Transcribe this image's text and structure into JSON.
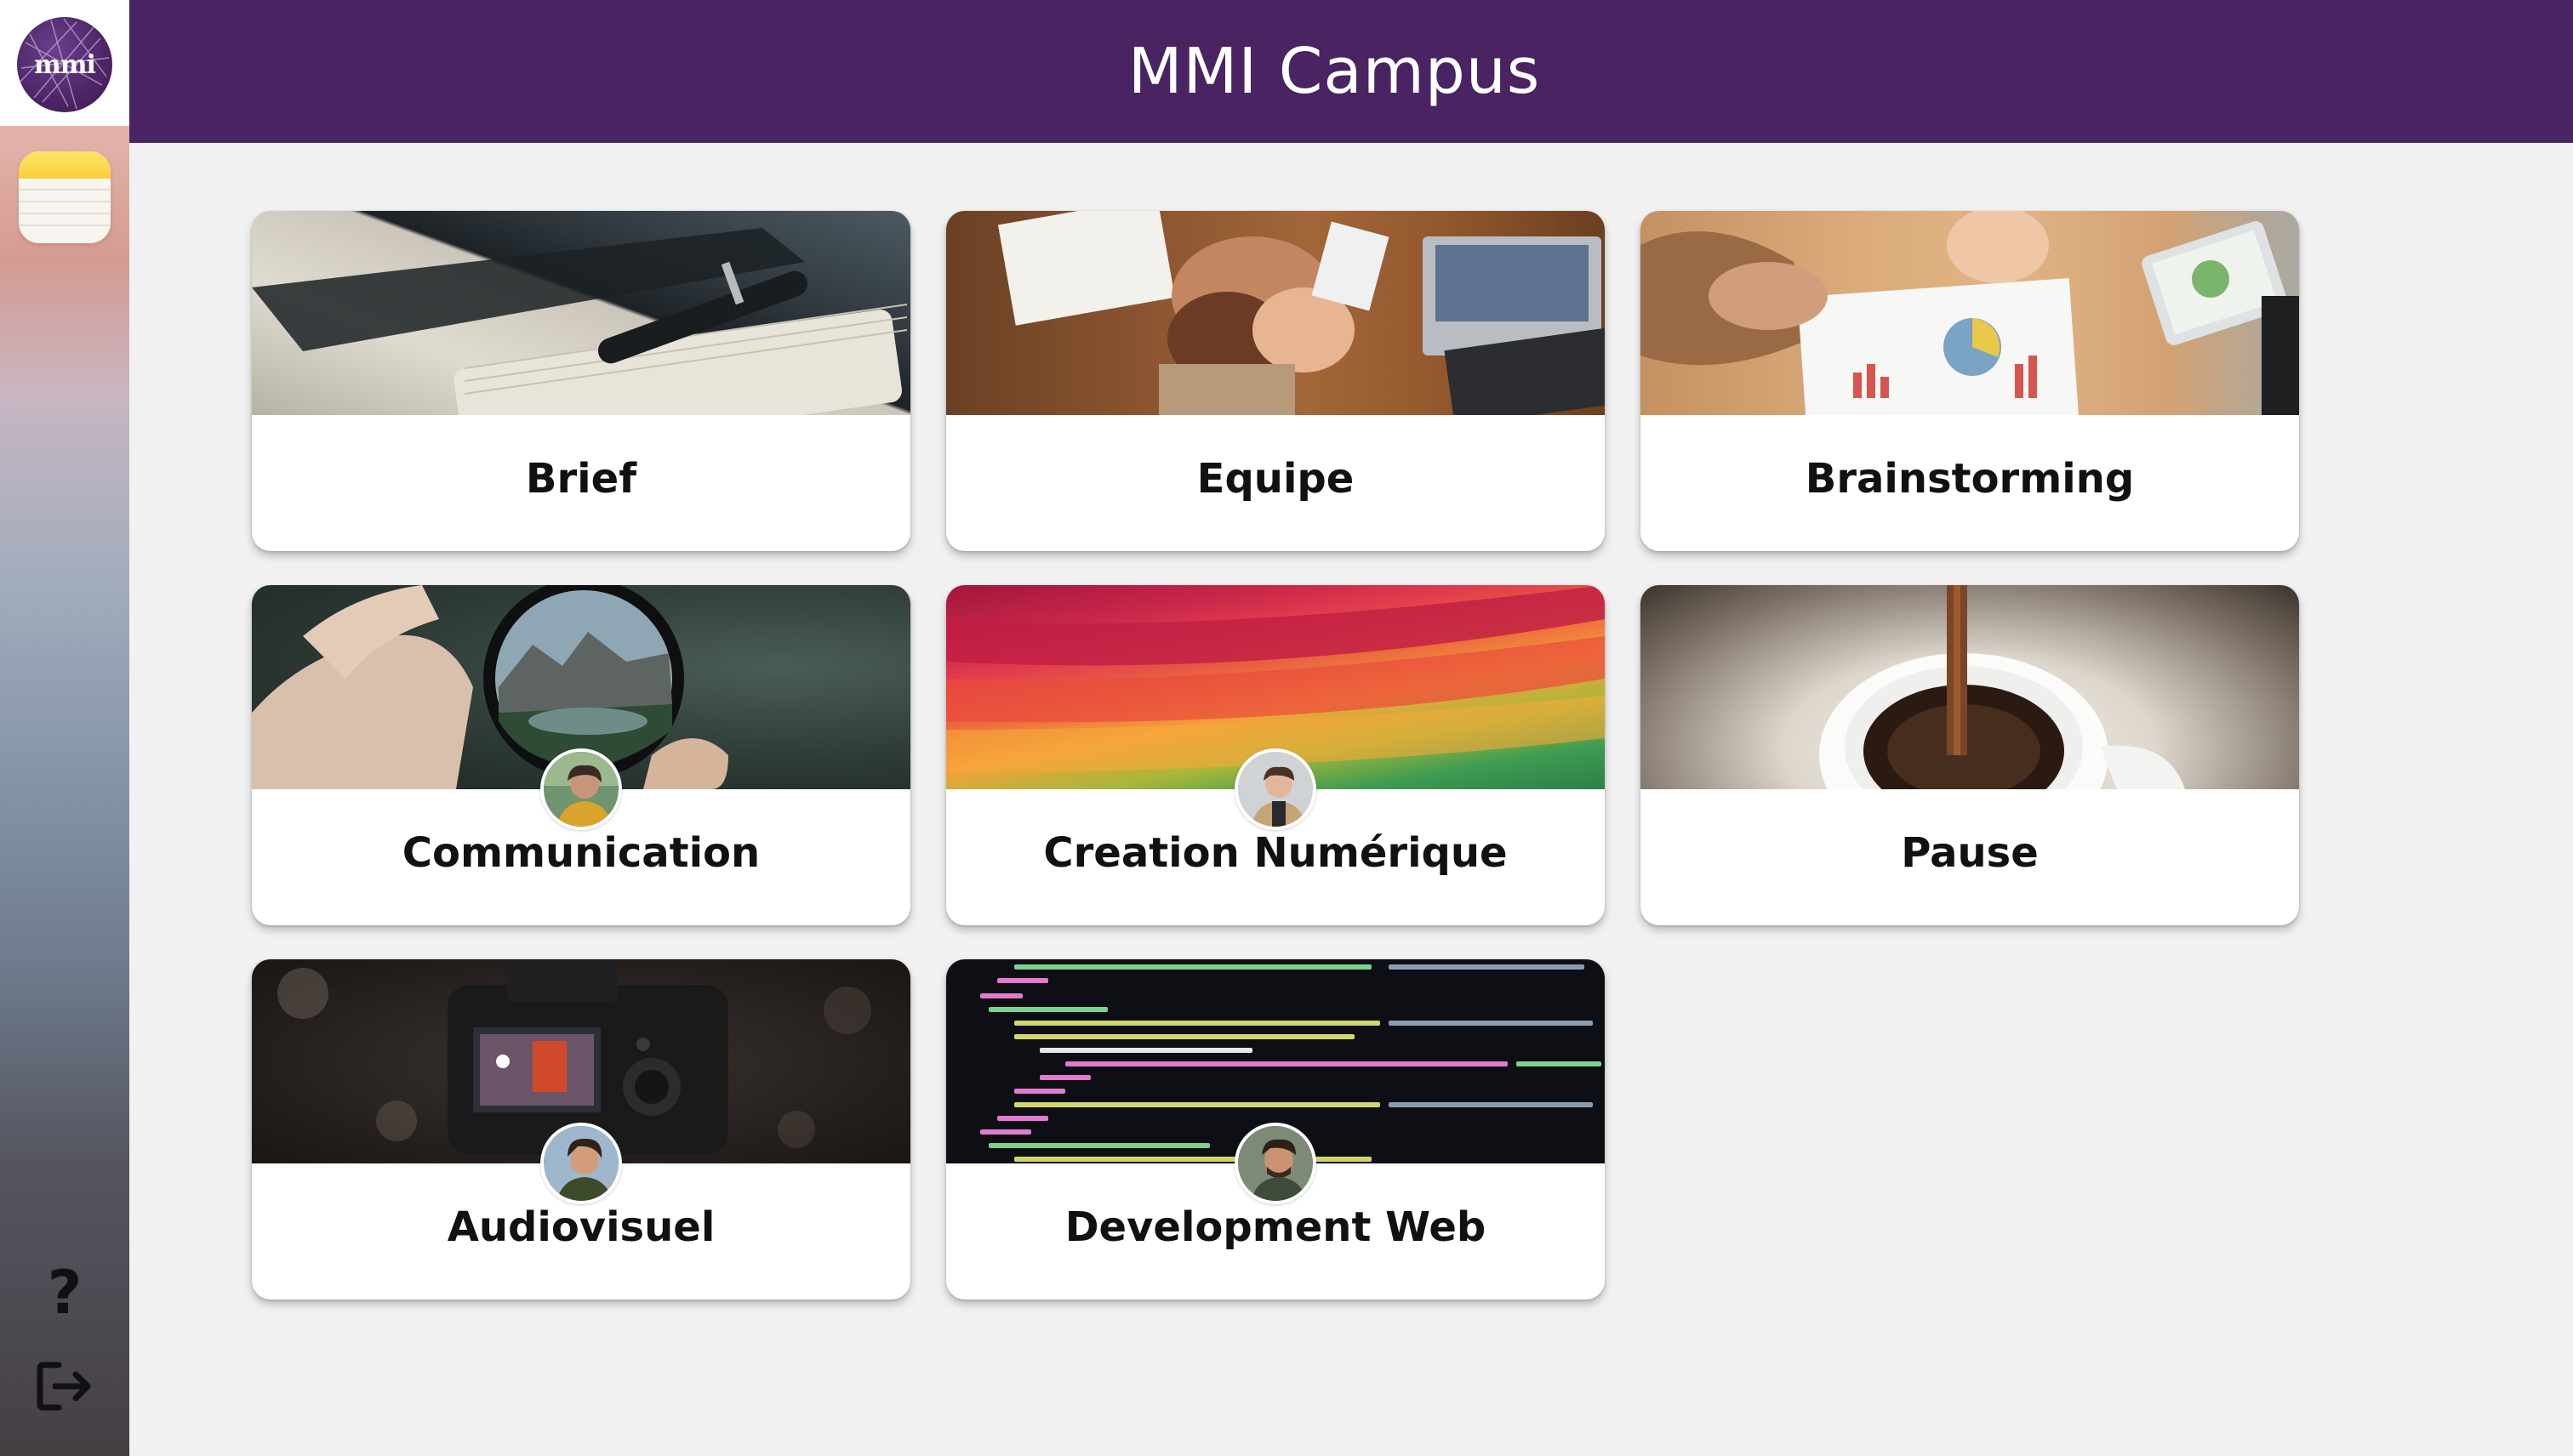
{
  "app": {
    "title": "MMI Campus",
    "logo_text": "mmi",
    "brand_color": "#4a2362"
  },
  "sidebar": {
    "icons": [
      {
        "name": "mmi-logo-icon"
      },
      {
        "name": "notes-app-icon"
      },
      {
        "name": "help-icon",
        "glyph": "?"
      },
      {
        "name": "logout-icon"
      }
    ]
  },
  "cards": [
    {
      "id": "brief",
      "label": "Brief",
      "image": "notebook-and-pen",
      "has_avatar": false
    },
    {
      "id": "equipe",
      "label": "Equipe",
      "image": "team-hands-stacked",
      "has_avatar": false
    },
    {
      "id": "brainstorming",
      "label": "Brainstorming",
      "image": "people-analyzing-charts",
      "has_avatar": false
    },
    {
      "id": "communication",
      "label": "Communication",
      "image": "lens-ball-mountain-landscape",
      "has_avatar": true
    },
    {
      "id": "creation",
      "label": "Creation Numérique",
      "image": "colorful-paper-waves",
      "has_avatar": true
    },
    {
      "id": "pause",
      "label": "Pause",
      "image": "coffee-pouring-cup",
      "has_avatar": false
    },
    {
      "id": "audiovisuel",
      "label": "Audiovisuel",
      "image": "canon-camera",
      "has_avatar": true
    },
    {
      "id": "devweb",
      "label": "Development Web",
      "image": "html-code-screen",
      "has_avatar": true
    }
  ]
}
